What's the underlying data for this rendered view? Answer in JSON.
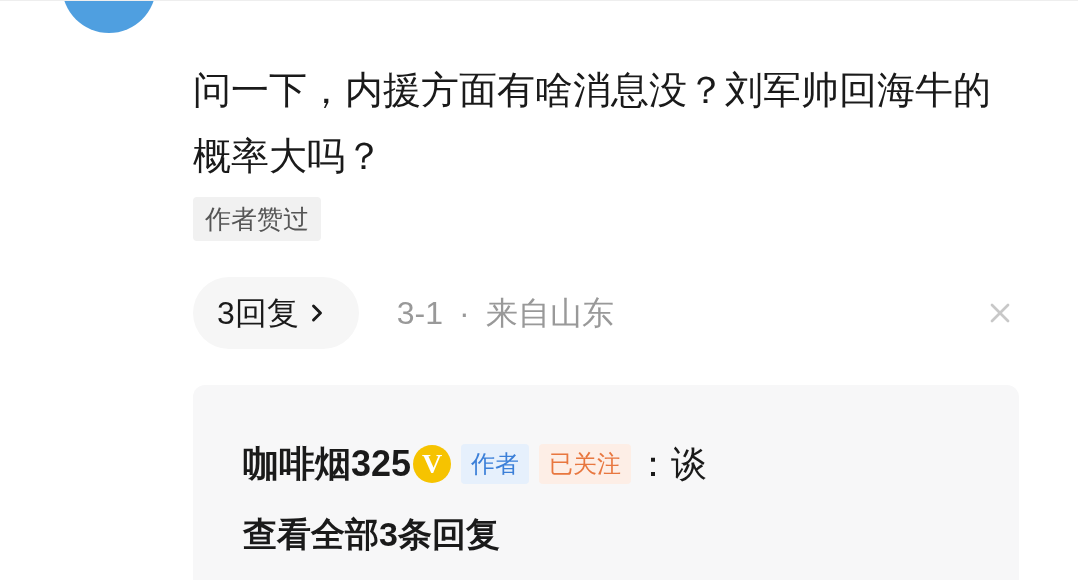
{
  "comment": {
    "text": "问一下，内援方面有啥消息没？刘军帅回海牛的概率大吗？",
    "tag": "作者赞过",
    "reply_button": "3回复",
    "date": "3-1",
    "separator": "·",
    "location": "来自山东"
  },
  "replies": {
    "author": "咖啡烟325",
    "verified_mark": "V",
    "badges": [
      {
        "label": "作者",
        "kind": "author"
      },
      {
        "label": "已关注",
        "kind": "following"
      }
    ],
    "snippet": "：谈",
    "view_all": "查看全部3条回复"
  }
}
